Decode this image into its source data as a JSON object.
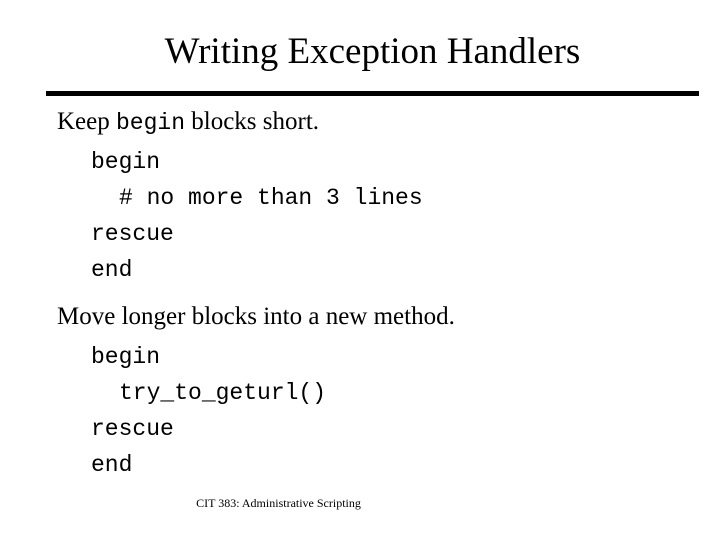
{
  "slide": {
    "title": "Writing Exception Handlers",
    "footer": "CIT 383: Administrative Scripting",
    "sections": [
      {
        "bullet_prefix": "Keep ",
        "bullet_code": "begin",
        "bullet_suffix": " blocks short.",
        "code": [
          "begin",
          "# no more than 3 lines",
          "rescue",
          "end"
        ]
      },
      {
        "bullet_prefix": "Move longer blocks into a new method.",
        "bullet_code": "",
        "bullet_suffix": "",
        "code": [
          "begin",
          "try_to_geturl()",
          "rescue",
          "end"
        ]
      }
    ]
  },
  "colors": {
    "background": "#ffffff",
    "text": "#000000",
    "rule": "#000000"
  }
}
